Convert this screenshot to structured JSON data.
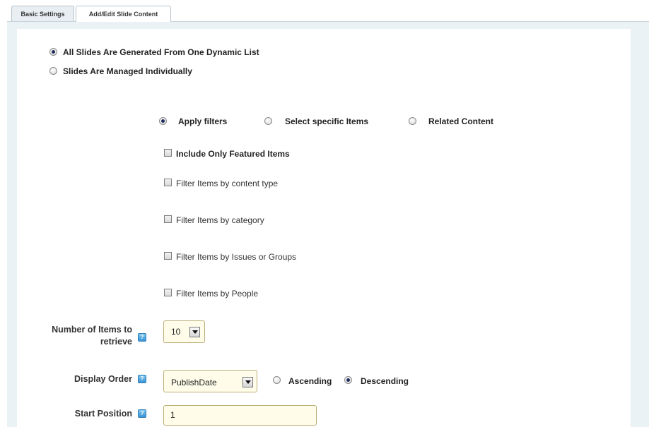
{
  "tabs": {
    "basic_settings": "Basic Settings",
    "add_edit_slide_content": "Add/Edit Slide Content"
  },
  "source_options": {
    "dynamic_list": {
      "label": "All Slides Are Generated From One Dynamic List",
      "selected": true
    },
    "managed_individually": {
      "label": "Slides Are Managed Individually",
      "selected": false
    }
  },
  "mode_options": {
    "apply_filters": {
      "label": "Apply filters",
      "selected": true
    },
    "select_specific": {
      "label": "Select specific Items",
      "selected": false
    },
    "related_content": {
      "label": "Related Content",
      "selected": false
    }
  },
  "filters": {
    "featured": {
      "label": "Include Only Featured Items",
      "checked": false
    },
    "content_type": {
      "label": "Filter Items by content type",
      "checked": false
    },
    "category": {
      "label": "Filter Items by category",
      "checked": false
    },
    "issues_groups": {
      "label": "Filter Items by Issues or Groups",
      "checked": false
    },
    "people": {
      "label": "Filter Items by People",
      "checked": false
    }
  },
  "num_items": {
    "label_line1": "Number of Items to",
    "label_line2": "retrieve",
    "value": "10"
  },
  "display_order": {
    "label": "Display Order",
    "value": "PublishDate",
    "ascending": {
      "label": "Ascending",
      "selected": false
    },
    "descending": {
      "label": "Descending",
      "selected": true
    }
  },
  "start_position": {
    "label": "Start Position",
    "value": "1"
  },
  "help_icon_glyph": "?"
}
